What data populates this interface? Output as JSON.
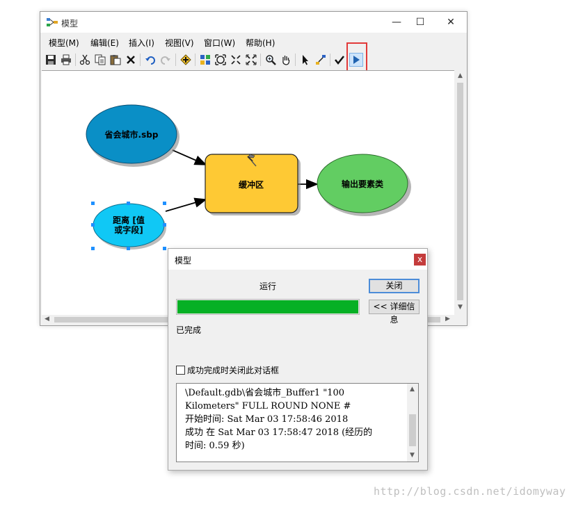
{
  "window": {
    "title": "模型",
    "controls": {
      "minimize": "—",
      "maximize": "☐",
      "close": "✕"
    }
  },
  "menu": [
    {
      "label": "模型(M)"
    },
    {
      "label": "编辑(E)"
    },
    {
      "label": "插入(I)"
    },
    {
      "label": "视图(V)"
    },
    {
      "label": "窗口(W)"
    },
    {
      "label": "帮助(H)"
    }
  ],
  "toolbar": [
    "save-icon",
    "print-icon",
    "cut-icon",
    "copy-icon",
    "paste-icon",
    "delete-icon",
    "undo-icon",
    "redo-icon",
    "add-data-icon",
    "auto-layout-icon",
    "full-extent-icon",
    "zoom-in-fixed-icon",
    "zoom-out-fixed-icon",
    "zoom-icon",
    "pan-icon",
    "select-icon",
    "connect-icon",
    "validate-icon",
    "run-icon"
  ],
  "model": {
    "nodes": [
      {
        "id": "input-city",
        "label": "省会城市.sbp",
        "color": "#0a8fc6"
      },
      {
        "id": "distance",
        "label_line1": "距离 [值",
        "label_line2": "或字段]",
        "color": "#10c8f5"
      },
      {
        "id": "buffer",
        "label": "缓冲区",
        "color": "#fec934"
      },
      {
        "id": "output",
        "label": "输出要素类",
        "color": "#62cd62"
      }
    ]
  },
  "dialog": {
    "title": "模型",
    "close_label": "x",
    "status": "运行",
    "close_button": "关闭",
    "details_button": "<< 详细信息",
    "progress": 1.0,
    "progress_color": "#06b025",
    "done_text": "已完成",
    "checkbox_label": "成功完成时关闭此对话框",
    "log_lines": [
      "\\Default.gdb\\省会城市_Buffer1 \"100",
      "Kilometers\" FULL ROUND NONE #",
      "开始时间: Sat Mar 03 17:58:46 2018",
      "成功 在 Sat Mar 03 17:58:47 2018 (经历的",
      "时间: 0.59 秒)"
    ]
  },
  "watermark": "http://blog.csdn.net/idomyway"
}
